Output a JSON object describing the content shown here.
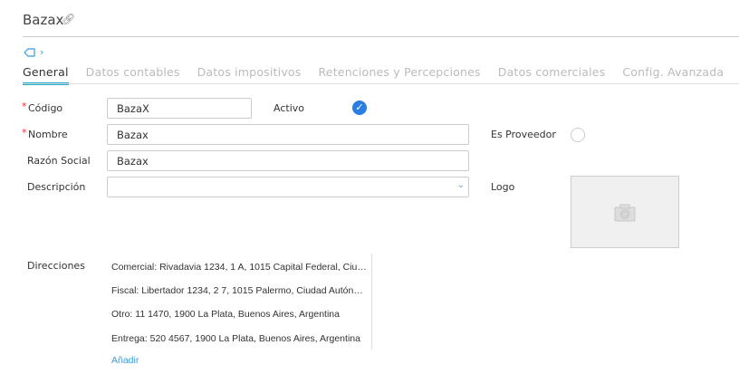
{
  "header": {
    "title": "Bazax",
    "link_icon": "link-icon"
  },
  "tabs": [
    {
      "label": "General",
      "active": true
    },
    {
      "label": "Datos contables"
    },
    {
      "label": "Datos impositivos"
    },
    {
      "label": "Retenciones y Percepciones"
    },
    {
      "label": "Datos comerciales"
    },
    {
      "label": "Config. Avanzada"
    }
  ],
  "form": {
    "codigo": {
      "label": "Código",
      "value": "BazaX",
      "required": "*"
    },
    "activo": {
      "label": "Activo",
      "checked": true
    },
    "nombre": {
      "label": "Nombre",
      "value": "Bazax",
      "required": "*"
    },
    "es_proveedor": {
      "label": "Es Proveedor",
      "checked": false
    },
    "razon_social": {
      "label": "Razón Social",
      "value": "Bazax"
    },
    "descripcion": {
      "label": "Descripción",
      "value": ""
    },
    "logo": {
      "label": "Logo"
    }
  },
  "direcciones": {
    "label": "Direcciones",
    "items": [
      "Comercial: Rivadavia 1234, 1 A, 1015 Capital Federal, Ciu…",
      "Fiscal: Libertador 1234, 2 7, 1015 Palermo, Ciudad Autón…",
      "Otro: 11 1470, 1900 La Plata, Buenos Aires, Argentina",
      "Entrega: 520 4567, 1900 La Plata, Buenos Aires, Argentina"
    ],
    "add_label": "Añadir"
  },
  "colors": {
    "accent": "#1fa7c9",
    "link": "#3b9be0",
    "check": "#2a7de1"
  }
}
